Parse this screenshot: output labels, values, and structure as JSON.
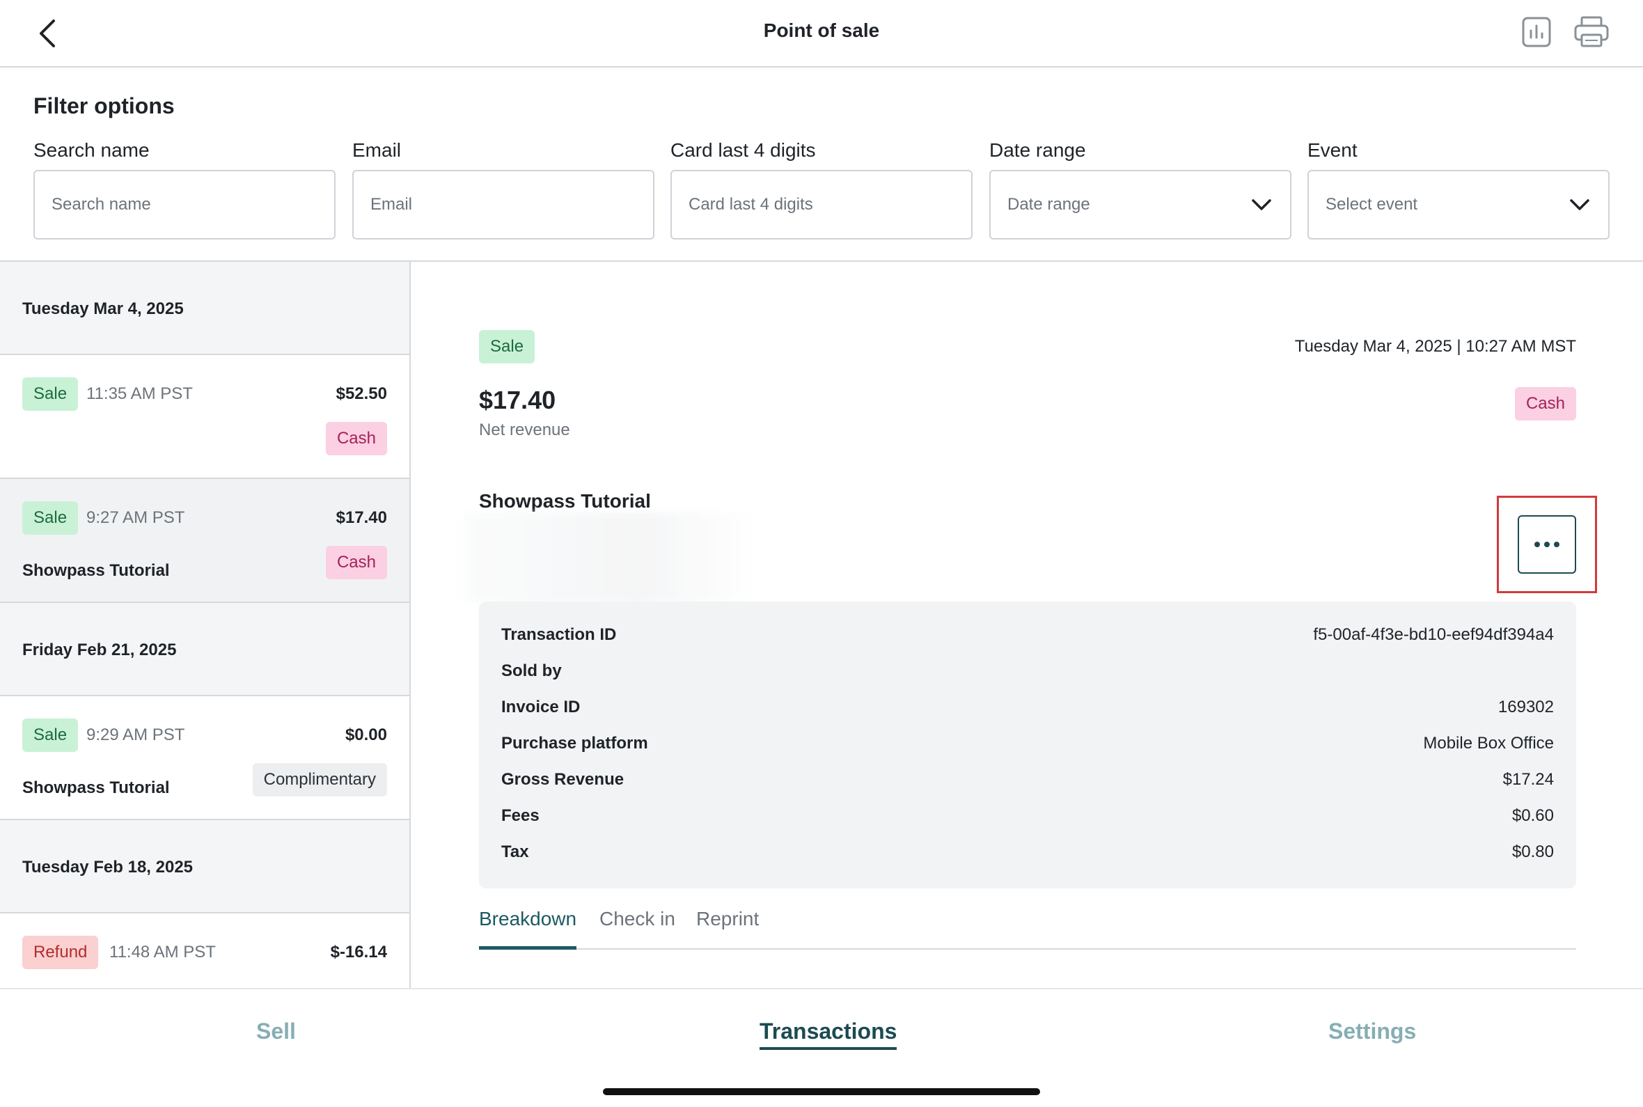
{
  "header": {
    "title": "Point of sale"
  },
  "filters": {
    "title": "Filter options",
    "search": {
      "label": "Search name",
      "placeholder": "Search name"
    },
    "email": {
      "label": "Email",
      "placeholder": "Email"
    },
    "card": {
      "label": "Card last 4 digits",
      "placeholder": "Card last 4 digits"
    },
    "date": {
      "label": "Date range",
      "placeholder": "Date range"
    },
    "event": {
      "label": "Event",
      "placeholder": "Select event"
    }
  },
  "list": {
    "dates": [
      "Tuesday Mar 4, 2025",
      "Friday Feb 21, 2025",
      "Tuesday Feb 18, 2025"
    ],
    "items": [
      {
        "type": "Sale",
        "time": "11:35 AM PST",
        "amount": "$52.50",
        "event": "",
        "method": "Cash"
      },
      {
        "type": "Sale",
        "time": "9:27 AM PST",
        "amount": "$17.40",
        "event": "Showpass Tutorial",
        "method": "Cash"
      },
      {
        "type": "Sale",
        "time": "9:29 AM PST",
        "amount": "$0.00",
        "event": "Showpass Tutorial",
        "method": "Complimentary"
      },
      {
        "type": "Refund",
        "time": "11:48 AM PST",
        "amount": "$-16.14",
        "event": "",
        "method": ""
      }
    ]
  },
  "detail": {
    "type": "Sale",
    "datetime": "Tuesday Mar 4, 2025 | 10:27 AM MST",
    "amount": "$17.40",
    "amount_label": "Net revenue",
    "method": "Cash",
    "event": "Showpass Tutorial",
    "info": [
      {
        "key": "Transaction ID",
        "value": "f5-00af-4f3e-bd10-eef94df394a4"
      },
      {
        "key": "Sold by",
        "value": ""
      },
      {
        "key": "Invoice ID",
        "value": "169302"
      },
      {
        "key": "Purchase platform",
        "value": "Mobile Box Office"
      },
      {
        "key": "Gross Revenue",
        "value": "$17.24"
      },
      {
        "key": "Fees",
        "value": "$0.60"
      },
      {
        "key": "Tax",
        "value": "$0.80"
      }
    ],
    "tabs": [
      "Breakdown",
      "Check in",
      "Reprint"
    ]
  },
  "bottom_nav": {
    "sell": "Sell",
    "transactions": "Transactions",
    "settings": "Settings"
  },
  "colors": {
    "accent": "#1c4a52",
    "sale": "#c9f1d6",
    "cash": "#fbd0e2",
    "refund": "#fbd0d0",
    "highlight": "#d33a3a"
  }
}
